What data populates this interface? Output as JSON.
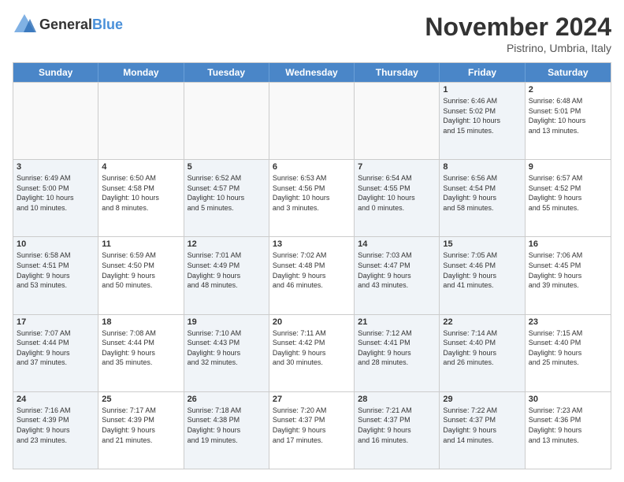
{
  "logo": {
    "general": "General",
    "blue": "Blue"
  },
  "header": {
    "month": "November 2024",
    "location": "Pistrino, Umbria, Italy"
  },
  "weekdays": [
    "Sunday",
    "Monday",
    "Tuesday",
    "Wednesday",
    "Thursday",
    "Friday",
    "Saturday"
  ],
  "rows": [
    [
      {
        "day": "",
        "info": "",
        "empty": true
      },
      {
        "day": "",
        "info": "",
        "empty": true
      },
      {
        "day": "",
        "info": "",
        "empty": true
      },
      {
        "day": "",
        "info": "",
        "empty": true
      },
      {
        "day": "",
        "info": "",
        "empty": true
      },
      {
        "day": "1",
        "info": "Sunrise: 6:46 AM\nSunset: 5:02 PM\nDaylight: 10 hours\nand 15 minutes.",
        "shaded": true
      },
      {
        "day": "2",
        "info": "Sunrise: 6:48 AM\nSunset: 5:01 PM\nDaylight: 10 hours\nand 13 minutes."
      }
    ],
    [
      {
        "day": "3",
        "info": "Sunrise: 6:49 AM\nSunset: 5:00 PM\nDaylight: 10 hours\nand 10 minutes.",
        "shaded": true
      },
      {
        "day": "4",
        "info": "Sunrise: 6:50 AM\nSunset: 4:58 PM\nDaylight: 10 hours\nand 8 minutes."
      },
      {
        "day": "5",
        "info": "Sunrise: 6:52 AM\nSunset: 4:57 PM\nDaylight: 10 hours\nand 5 minutes.",
        "shaded": true
      },
      {
        "day": "6",
        "info": "Sunrise: 6:53 AM\nSunset: 4:56 PM\nDaylight: 10 hours\nand 3 minutes."
      },
      {
        "day": "7",
        "info": "Sunrise: 6:54 AM\nSunset: 4:55 PM\nDaylight: 10 hours\nand 0 minutes.",
        "shaded": true
      },
      {
        "day": "8",
        "info": "Sunrise: 6:56 AM\nSunset: 4:54 PM\nDaylight: 9 hours\nand 58 minutes.",
        "shaded": true
      },
      {
        "day": "9",
        "info": "Sunrise: 6:57 AM\nSunset: 4:52 PM\nDaylight: 9 hours\nand 55 minutes."
      }
    ],
    [
      {
        "day": "10",
        "info": "Sunrise: 6:58 AM\nSunset: 4:51 PM\nDaylight: 9 hours\nand 53 minutes.",
        "shaded": true
      },
      {
        "day": "11",
        "info": "Sunrise: 6:59 AM\nSunset: 4:50 PM\nDaylight: 9 hours\nand 50 minutes."
      },
      {
        "day": "12",
        "info": "Sunrise: 7:01 AM\nSunset: 4:49 PM\nDaylight: 9 hours\nand 48 minutes.",
        "shaded": true
      },
      {
        "day": "13",
        "info": "Sunrise: 7:02 AM\nSunset: 4:48 PM\nDaylight: 9 hours\nand 46 minutes."
      },
      {
        "day": "14",
        "info": "Sunrise: 7:03 AM\nSunset: 4:47 PM\nDaylight: 9 hours\nand 43 minutes.",
        "shaded": true
      },
      {
        "day": "15",
        "info": "Sunrise: 7:05 AM\nSunset: 4:46 PM\nDaylight: 9 hours\nand 41 minutes.",
        "shaded": true
      },
      {
        "day": "16",
        "info": "Sunrise: 7:06 AM\nSunset: 4:45 PM\nDaylight: 9 hours\nand 39 minutes."
      }
    ],
    [
      {
        "day": "17",
        "info": "Sunrise: 7:07 AM\nSunset: 4:44 PM\nDaylight: 9 hours\nand 37 minutes.",
        "shaded": true
      },
      {
        "day": "18",
        "info": "Sunrise: 7:08 AM\nSunset: 4:44 PM\nDaylight: 9 hours\nand 35 minutes."
      },
      {
        "day": "19",
        "info": "Sunrise: 7:10 AM\nSunset: 4:43 PM\nDaylight: 9 hours\nand 32 minutes.",
        "shaded": true
      },
      {
        "day": "20",
        "info": "Sunrise: 7:11 AM\nSunset: 4:42 PM\nDaylight: 9 hours\nand 30 minutes."
      },
      {
        "day": "21",
        "info": "Sunrise: 7:12 AM\nSunset: 4:41 PM\nDaylight: 9 hours\nand 28 minutes.",
        "shaded": true
      },
      {
        "day": "22",
        "info": "Sunrise: 7:14 AM\nSunset: 4:40 PM\nDaylight: 9 hours\nand 26 minutes.",
        "shaded": true
      },
      {
        "day": "23",
        "info": "Sunrise: 7:15 AM\nSunset: 4:40 PM\nDaylight: 9 hours\nand 25 minutes."
      }
    ],
    [
      {
        "day": "24",
        "info": "Sunrise: 7:16 AM\nSunset: 4:39 PM\nDaylight: 9 hours\nand 23 minutes.",
        "shaded": true
      },
      {
        "day": "25",
        "info": "Sunrise: 7:17 AM\nSunset: 4:39 PM\nDaylight: 9 hours\nand 21 minutes."
      },
      {
        "day": "26",
        "info": "Sunrise: 7:18 AM\nSunset: 4:38 PM\nDaylight: 9 hours\nand 19 minutes.",
        "shaded": true
      },
      {
        "day": "27",
        "info": "Sunrise: 7:20 AM\nSunset: 4:37 PM\nDaylight: 9 hours\nand 17 minutes."
      },
      {
        "day": "28",
        "info": "Sunrise: 7:21 AM\nSunset: 4:37 PM\nDaylight: 9 hours\nand 16 minutes.",
        "shaded": true
      },
      {
        "day": "29",
        "info": "Sunrise: 7:22 AM\nSunset: 4:37 PM\nDaylight: 9 hours\nand 14 minutes.",
        "shaded": true
      },
      {
        "day": "30",
        "info": "Sunrise: 7:23 AM\nSunset: 4:36 PM\nDaylight: 9 hours\nand 13 minutes."
      }
    ]
  ]
}
